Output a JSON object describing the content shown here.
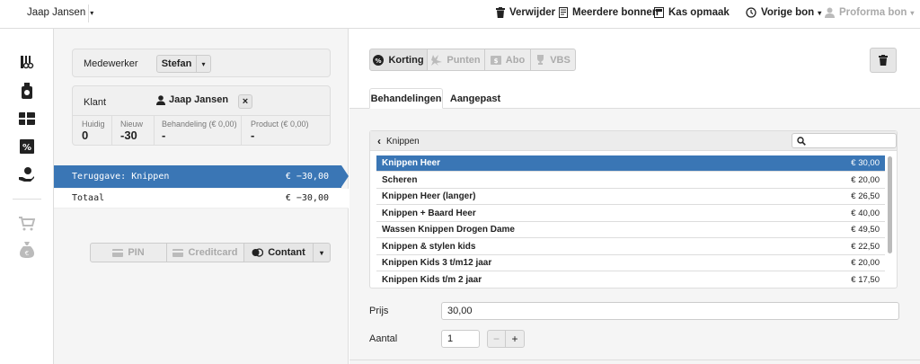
{
  "topbar": {
    "customer": "Jaap Jansen",
    "delete": "Verwijder",
    "multiple_receipts": "Meerdere bonnen",
    "cash_up": "Kas opmaak",
    "previous": "Vorige bon",
    "proforma": "Proforma bon"
  },
  "employee": {
    "label": "Medewerker",
    "value": "Stefan"
  },
  "client": {
    "label": "Klant",
    "name": "Jaap Jansen",
    "remove": "×"
  },
  "stats": [
    {
      "label": "Huidig",
      "value": "0"
    },
    {
      "label": "Nieuw",
      "value": "-30"
    },
    {
      "label": "Behandeling (€ 0,00)",
      "value": "-"
    },
    {
      "label": "Product (€ 0,00)",
      "value": "-"
    }
  ],
  "lines": [
    {
      "label": "Teruggave: Knippen",
      "amount": "€ −30,00"
    }
  ],
  "total": {
    "label": "Totaal",
    "amount": "€ −30,00"
  },
  "payment": {
    "pin": "PIN",
    "creditcard": "Creditcard",
    "cash": "Contant"
  },
  "right_tabs_top": [
    "Korting",
    "Punten",
    "Abo",
    "VBS"
  ],
  "tabs": [
    "Behandelingen",
    "Aangepast"
  ],
  "breadcrumb": "Knippen",
  "treatments": [
    {
      "name": "Knippen Heer",
      "price": "€ 30,00"
    },
    {
      "name": "Scheren",
      "price": "€ 20,00"
    },
    {
      "name": "Knippen Heer (langer)",
      "price": "€ 26,50"
    },
    {
      "name": "Knippen + Baard Heer",
      "price": "€ 40,00"
    },
    {
      "name": "Wassen Knippen Drogen Dame",
      "price": "€ 49,50"
    },
    {
      "name": "Knippen & stylen kids",
      "price": "€ 22,50"
    },
    {
      "name": "Knippen Kids 3 t/m12 jaar",
      "price": "€ 20,00"
    },
    {
      "name": "Knippen Kids t/m 2 jaar",
      "price": "€ 17,50"
    }
  ],
  "price": {
    "label": "Prijs",
    "value": "30,00"
  },
  "quantity": {
    "label": "Aantal",
    "value": "1",
    "minus": "−",
    "plus": "+"
  },
  "colors": {
    "accent": "#3a76b5"
  }
}
